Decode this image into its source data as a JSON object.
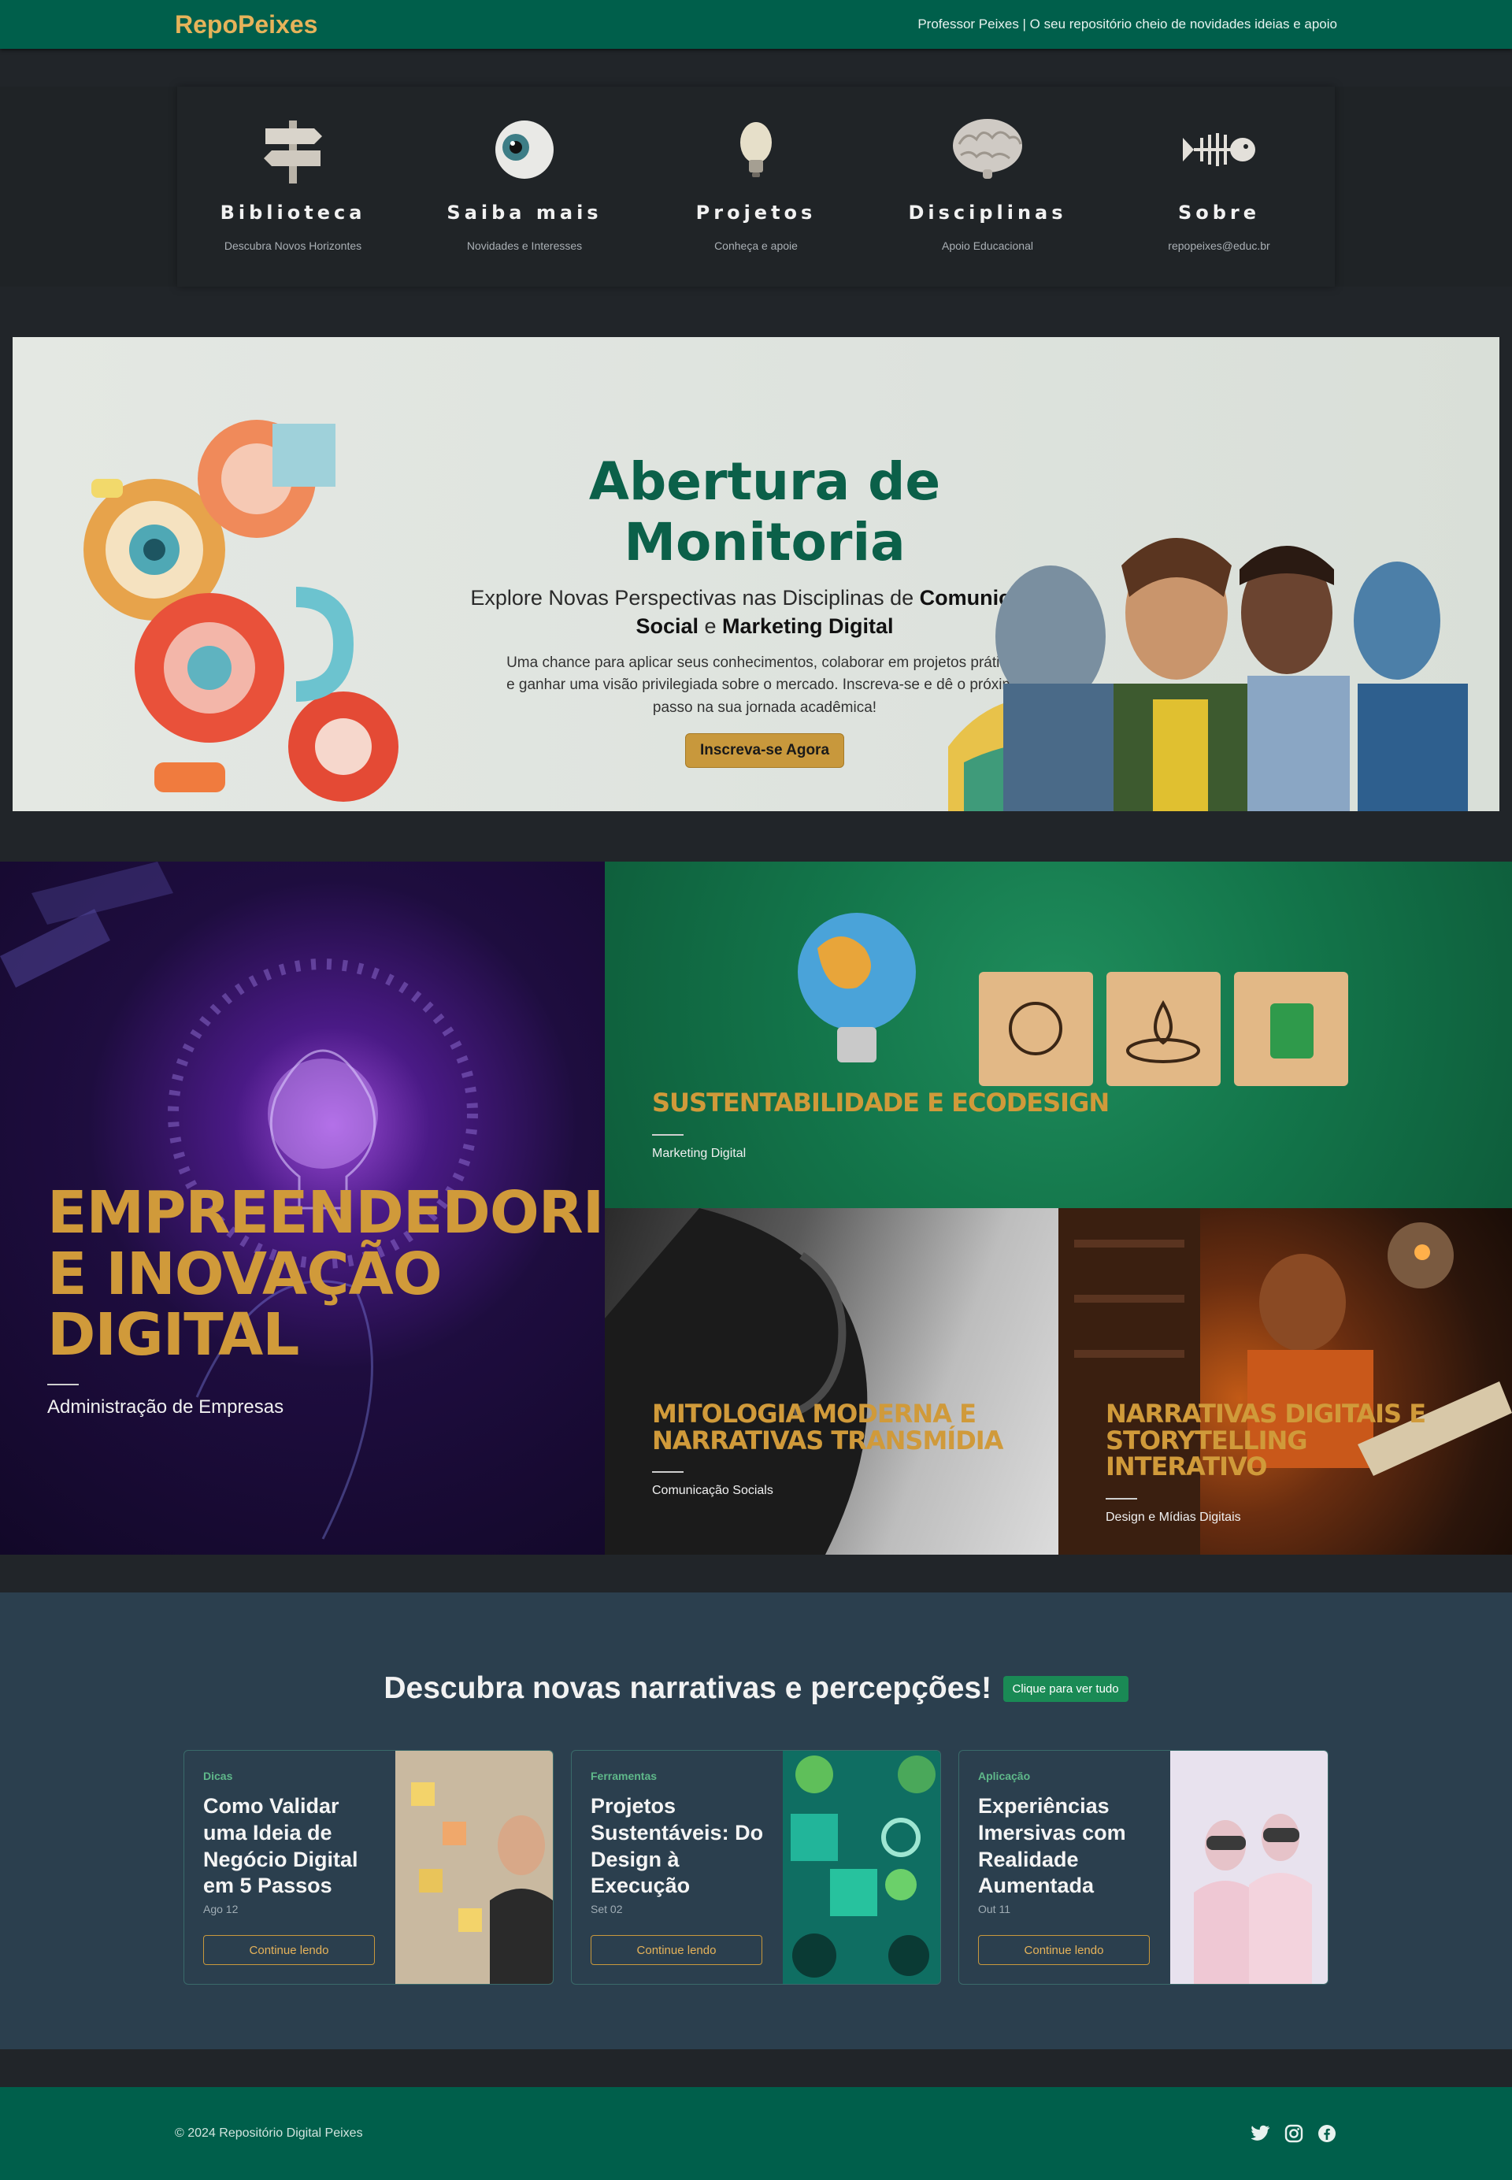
{
  "header": {
    "brand": "RepoPeixes",
    "tagline": "Professor Peixes | O seu repositório cheio de novidades ideias e apoio"
  },
  "nav": [
    {
      "icon": "signpost-icon",
      "title": "Biblioteca",
      "subtitle": "Descubra Novos Horizontes"
    },
    {
      "icon": "eye-icon",
      "title": "Saiba mais",
      "subtitle": "Novidades e Interesses"
    },
    {
      "icon": "lightbulb-icon",
      "title": "Projetos",
      "subtitle": "Conheça e apoie"
    },
    {
      "icon": "brain-icon",
      "title": "Disciplinas",
      "subtitle": "Apoio Educacional"
    },
    {
      "icon": "fish-skeleton-icon",
      "title": "Sobre",
      "subtitle": "repopeixes@educ.br"
    }
  ],
  "hero": {
    "title": "Abertura de Monitoria",
    "subtitle_prefix": "Explore Novas Perspectivas nas Disciplinas de ",
    "subtitle_bold1": "Comunicação Social",
    "subtitle_mid": " e ",
    "subtitle_bold2": "Marketing Digital",
    "text": "Uma chance para aplicar seus conhecimentos, colaborar em projetos práticos e ganhar uma visão privilegiada sobre o mercado. Inscreva-se e dê o próximo passo na sua jornada acadêmica!",
    "button": "Inscreva-se Agora"
  },
  "featured": [
    {
      "title": "Empreendedorismo e Inovação Digital",
      "category": "Administração de Empresas"
    },
    {
      "title": "Sustentabilidade e Ecodesign",
      "category": "Marketing Digital"
    },
    {
      "title": "Mitologia Moderna e Narrativas Transmídia",
      "category": "Comunicação Socials"
    },
    {
      "title": "Narrativas Digitais e Storytelling Interativo",
      "category": "Design e Mídias Digitais"
    }
  ],
  "discover": {
    "title": "Descubra novas narrativas e percepções!",
    "badge": "Clique para ver tudo",
    "cards": [
      {
        "category": "Dicas",
        "title": "Como Validar uma Ideia de Negócio Digital em 5 Passos",
        "date": "Ago 12",
        "button": "Continue lendo"
      },
      {
        "category": "Ferramentas",
        "title": "Projetos Sustentáveis: Do Design à Execução",
        "date": "Set 02",
        "button": "Continue lendo"
      },
      {
        "category": "Aplicação",
        "title": "Experiências Imersivas com Realidade Aumentada",
        "date": "Out 11",
        "button": "Continue lendo"
      }
    ]
  },
  "footer": {
    "copyright": "© 2024 Repositório Digital Peixes",
    "socials": [
      "twitter-icon",
      "instagram-icon",
      "facebook-icon"
    ]
  },
  "colors": {
    "primary_green": "#005f4b",
    "accent_gold": "#c8983c",
    "dark_bg": "#212529",
    "section_blue": "#2b3f4e"
  }
}
